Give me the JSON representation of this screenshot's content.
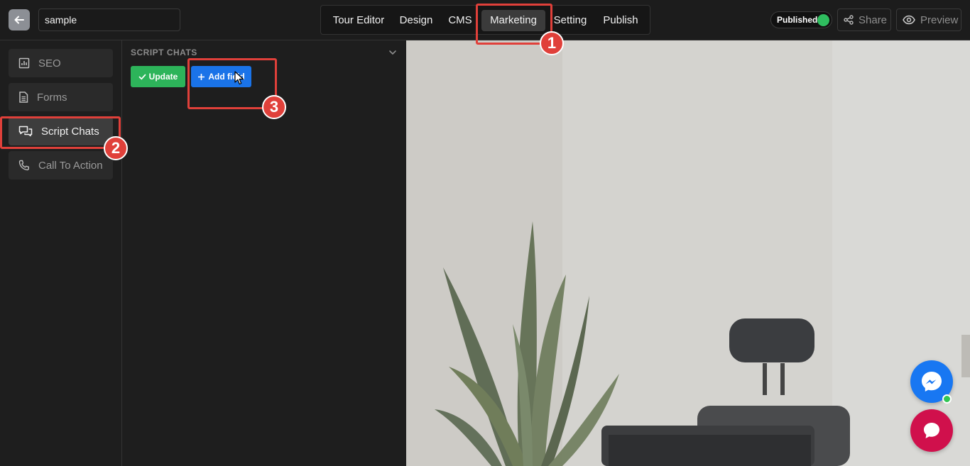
{
  "header": {
    "title_value": "sample",
    "nav": [
      "Tour Editor",
      "Design",
      "CMS",
      "Marketing",
      "Setting",
      "Publish"
    ],
    "active_nav": "Marketing",
    "status_label": "Published",
    "share_label": "Share",
    "preview_label": "Preview"
  },
  "sidebar": {
    "items": [
      {
        "label": "SEO",
        "icon": "chart-icon"
      },
      {
        "label": "Forms",
        "icon": "document-icon"
      },
      {
        "label": "Script Chats",
        "icon": "chat-icon"
      },
      {
        "label": "Call To Action",
        "icon": "phone-icon"
      }
    ],
    "active": "Script Chats"
  },
  "panel": {
    "title": "SCRIPT CHATS",
    "update_label": "Update",
    "add_field_label": "Add field"
  },
  "annotations": [
    "1",
    "2",
    "3"
  ],
  "colors": {
    "accent_blue": "#1a73e8",
    "success_green": "#2db45a",
    "annotation_red": "#e0403a",
    "messenger_blue": "#1877f2",
    "chat_crimson": "#d0104c"
  }
}
